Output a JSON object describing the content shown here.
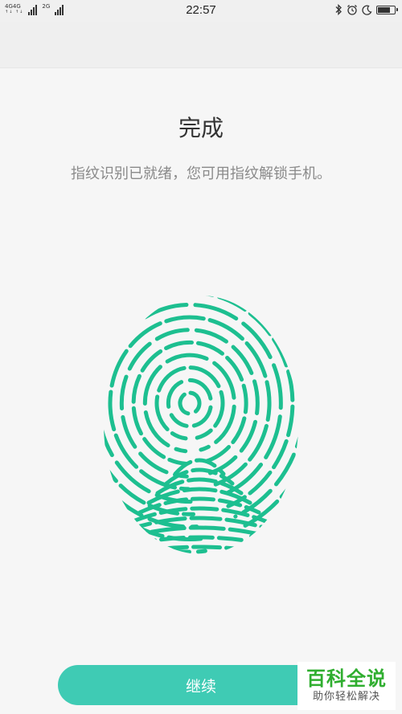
{
  "status_bar": {
    "network_1": "4G",
    "network_1b": "4G",
    "network_2": "2G",
    "time": "22:57",
    "battery_level": 0.8
  },
  "main": {
    "title": "完成",
    "subtitle": "指纹识别已就绪，您可用指纹解锁手机。",
    "accent_color": "#1dbf90"
  },
  "footer": {
    "continue_label": "继续",
    "button_color": "#3fcbb4"
  },
  "watermark": {
    "main": "百科全说",
    "sub": "助你轻松解决"
  }
}
